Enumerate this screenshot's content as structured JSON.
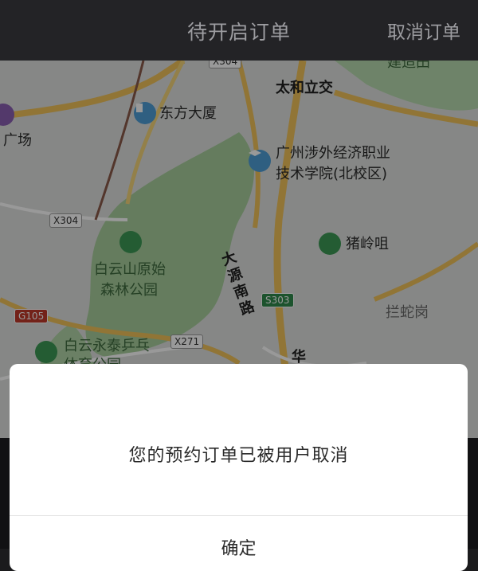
{
  "header": {
    "title": "待开启订单",
    "cancel_label": "取消订单"
  },
  "map": {
    "labels": {
      "dongfang": "东方大厦",
      "guangchang": "广场",
      "taihe": "太和立交",
      "college1": "广州涉外经济职业",
      "college2": "技术学院(北校区)",
      "zhuling": "猪岭咀",
      "baiyun1": "白云山原始",
      "baiyun2": "森林公园",
      "dayuan": "大源南路",
      "lanshe": "拦蛇岗",
      "yongtai1": "白云永泰乒乓",
      "yongtai2": "体育公园",
      "top_right": "建造田",
      "hua": "华"
    },
    "road_tags": {
      "x304": "X304",
      "x304_top": "X304",
      "x271": "X271",
      "s303": "S303",
      "g105": "G105"
    }
  },
  "modal": {
    "message": "您的预约订单已被用户取消",
    "confirm_label": "确定"
  }
}
